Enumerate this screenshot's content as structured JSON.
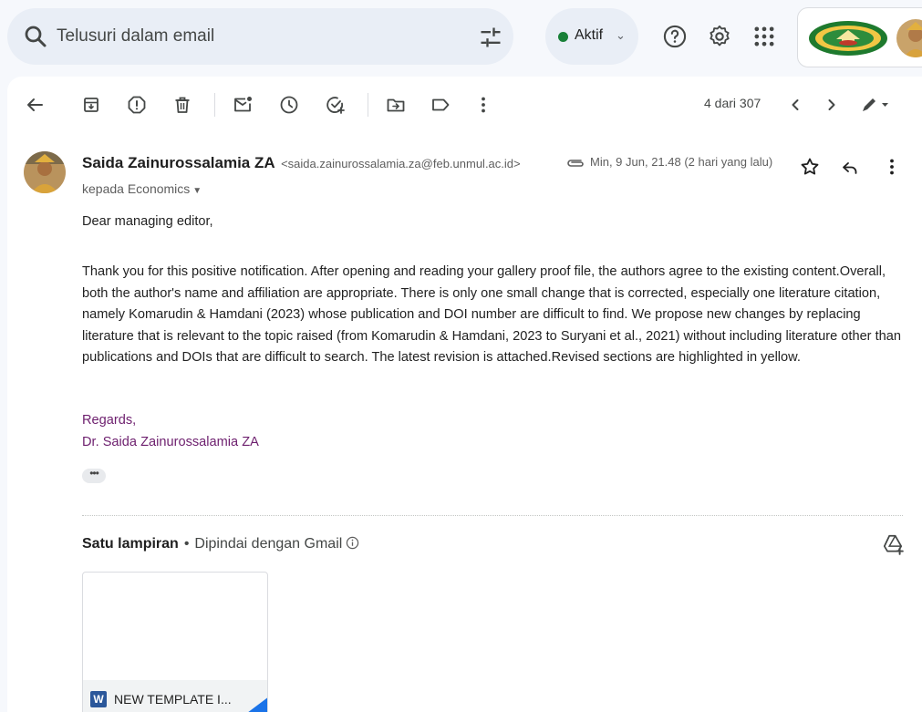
{
  "search": {
    "placeholder": "Telusuri dalam email"
  },
  "status": {
    "label": "Aktif",
    "color": "#188038"
  },
  "toolbar": {
    "pager": "4 dari 307",
    "icons": [
      "back-arrow-icon",
      "archive-icon",
      "report-spam-icon",
      "delete-icon",
      "mark-unread-icon",
      "snooze-icon",
      "add-to-tasks-icon",
      "move-to-icon",
      "label-icon",
      "more-vert-icon",
      "prev-icon",
      "next-icon",
      "pen-icon"
    ]
  },
  "message": {
    "sender_name": "Saida Zainurossalamia ZA",
    "sender_email": "<saida.zainurossalamia.za@feb.unmul.ac.id>",
    "to": "kepada Economics",
    "date": "Min, 9 Jun, 21.48 (2 hari yang lalu)",
    "greeting": "Dear managing editor,",
    "body": "Thank you for this positive notification. After opening and reading your gallery proof file, the authors agree to the existing content.Overall, both the author's name and affiliation are appropriate. There is only one small change that is corrected, especially one literature citation, namely Komarudin & Hamdani (2023) whose publication and DOI number are difficult to find. We propose new changes by replacing literature that is relevant to the topic raised (from Komarudin & Hamdani, 2023 to Suryani et al., 2021) without including literature other than publications and DOIs that are difficult to search. The latest revision is attached.Revised sections are highlighted in yellow.",
    "signature_line1": "Regards,",
    "signature_line2": "Dr. Saida Zainurossalamia ZA",
    "ellipsis": "•••",
    "signature_color": "#6d1f6e"
  },
  "attachments": {
    "count_label": "Satu lampiran",
    "separator": "•",
    "scan_label": "Dipindai dengan Gmail",
    "files": [
      {
        "name": "NEW TEMPLATE I...",
        "type_icon": "W"
      }
    ]
  }
}
